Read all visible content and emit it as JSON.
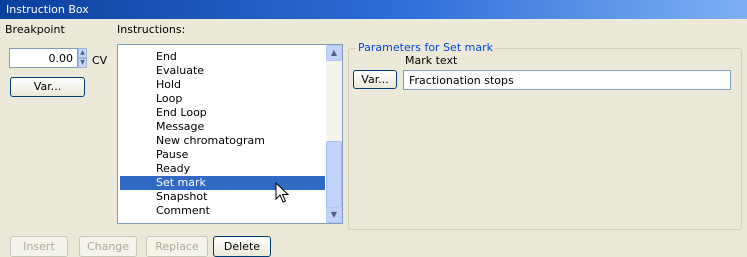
{
  "window": {
    "title": "Instruction Box"
  },
  "breakpoint": {
    "label": "Breakpoint",
    "value": "0.00",
    "unit": "CV",
    "var_button": "Var..."
  },
  "instructions": {
    "label": "Instructions:",
    "items": [
      "End",
      "Evaluate",
      "Hold",
      "Loop",
      "End Loop",
      "Message",
      "New chromatogram",
      "Pause",
      "Ready",
      "Set mark",
      "Snapshot",
      "Comment"
    ],
    "selected": "Set mark"
  },
  "parameters": {
    "group_title": "Parameters for Set mark",
    "mark_text_label": "Mark text",
    "var_button": "Var...",
    "mark_text_value": "Fractionation stops"
  },
  "actions": {
    "insert": "Insert",
    "change": "Change",
    "replace": "Replace",
    "delete": "Delete"
  },
  "colors": {
    "title_bar": "#2f6fd8",
    "selection": "#316ac5",
    "group_title": "#0046d5",
    "dialog_bg": "#ece9d8"
  }
}
